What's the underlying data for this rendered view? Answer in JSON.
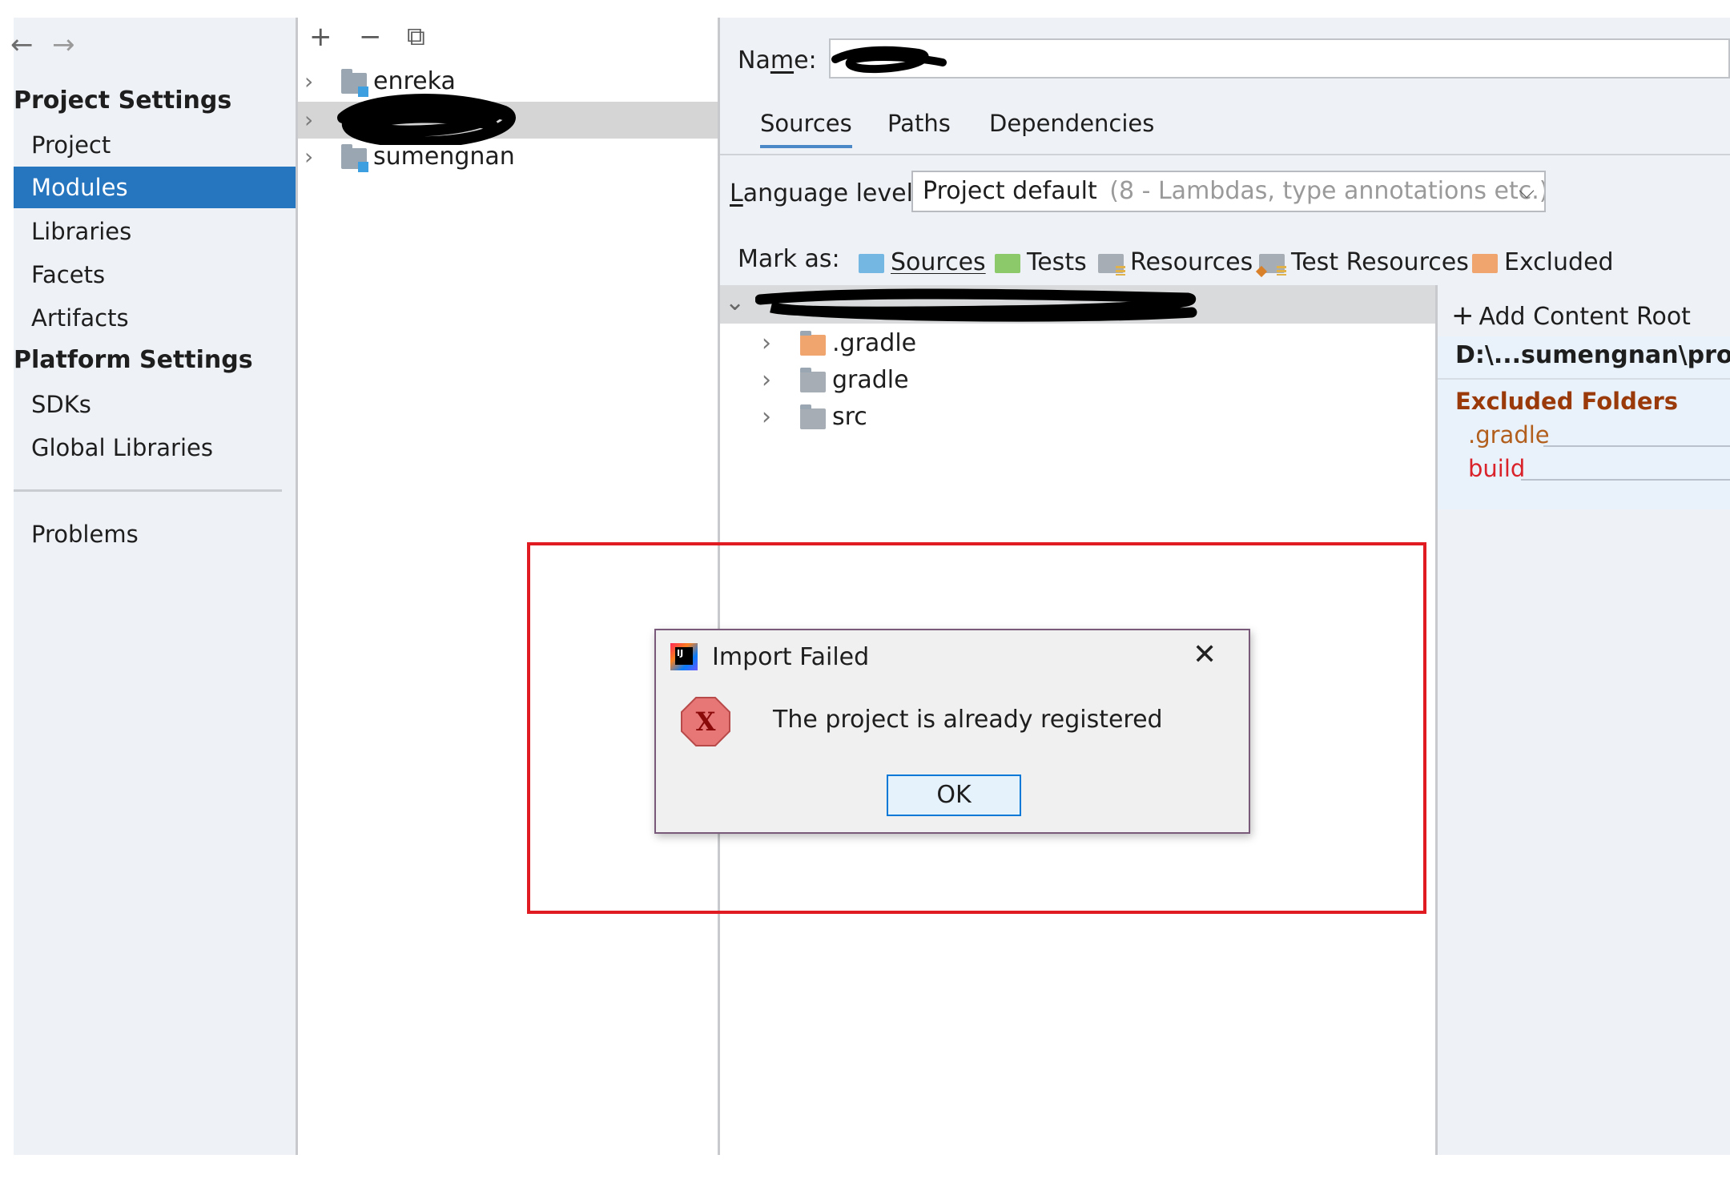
{
  "nav": {
    "back_arrow": "←",
    "forward_arrow": "→",
    "project_settings": "Project Settings",
    "platform_settings": "Platform Settings",
    "items_project": [
      "Project",
      "Modules",
      "Libraries",
      "Facets",
      "Artifacts"
    ],
    "items_platform": [
      "SDKs",
      "Global Libraries"
    ],
    "problems": "Problems",
    "selected": "Modules"
  },
  "modules_toolbar": {
    "add": "+",
    "remove": "−",
    "copy": "⧉"
  },
  "modules": [
    "enreka",
    "",
    "sumengnan"
  ],
  "module_detail": {
    "name_label": "Name:",
    "tabs": [
      "Sources",
      "Paths",
      "Dependencies"
    ],
    "active_tab": "Sources",
    "language_level_label": "Language level:",
    "language_level_value": "Project default",
    "language_level_hint": "(8 - Lambdas, type annotations etc.)",
    "mark_as_label": "Mark as:",
    "mark_as": [
      {
        "label": "Sources",
        "color": "#74b7e3"
      },
      {
        "label": "Tests",
        "color": "#8cc96b"
      },
      {
        "label": "Resources",
        "color": "#a6adb4"
      },
      {
        "label": "Test Resources",
        "color": "#a6adb4"
      },
      {
        "label": "Excluded",
        "color": "#f0a46e"
      }
    ],
    "tree": [
      ".gradle",
      "gradle",
      "src"
    ],
    "add_content_root": "Add Content Root",
    "content_root_path": "D:\\...sumengnan\\produc",
    "excluded_folders_title": "Excluded Folders",
    "excluded_folders": [
      ".gradle",
      "build"
    ]
  },
  "dialog": {
    "title": "Import Failed",
    "message": "The project is already registered",
    "ok": "OK",
    "app_icon_text": "IJ",
    "error_icon_text": "X"
  }
}
